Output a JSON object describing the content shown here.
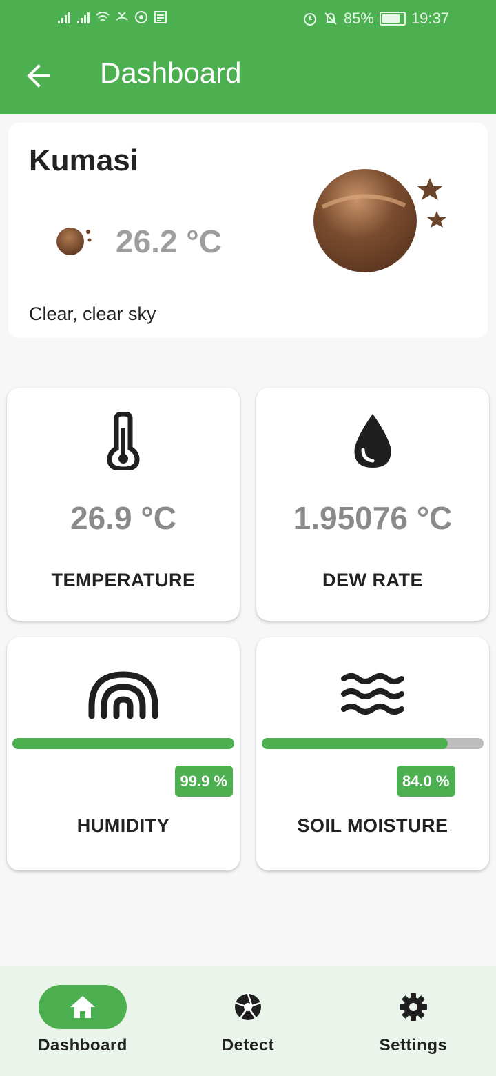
{
  "status_bar": {
    "battery": "85%",
    "time": "19:37",
    "battery_level": 0.85
  },
  "appbar": {
    "title": "Dashboard"
  },
  "weather": {
    "city": "Kumasi",
    "temperature": "26.2 °C",
    "description": "Clear, clear sky",
    "icon": "clear-night-icon"
  },
  "tiles": {
    "temperature": {
      "value": "26.9 °C",
      "label": "TEMPERATURE",
      "icon": "thermometer-icon"
    },
    "dew_rate": {
      "value": "1.95076 °C",
      "label": "DEW RATE",
      "icon": "water-drop-icon"
    },
    "humidity": {
      "percent": "99.9 %",
      "label": "HUMIDITY",
      "level": 0.999,
      "icon": "rainbow-icon"
    },
    "soil_moisture": {
      "percent": "84.0 %",
      "label": "SOIL MOISTURE",
      "level": 0.84,
      "icon": "waves-icon"
    }
  },
  "nav": {
    "items": [
      {
        "label": "Dashboard",
        "icon": "home-icon",
        "active": true
      },
      {
        "label": "Detect",
        "icon": "camera-aperture-icon",
        "active": false
      },
      {
        "label": "Settings",
        "icon": "gear-icon",
        "active": false
      }
    ]
  },
  "colors": {
    "primary": "#4caf50",
    "bar_track": "#bdbdbd",
    "planet": "#6b4429"
  }
}
